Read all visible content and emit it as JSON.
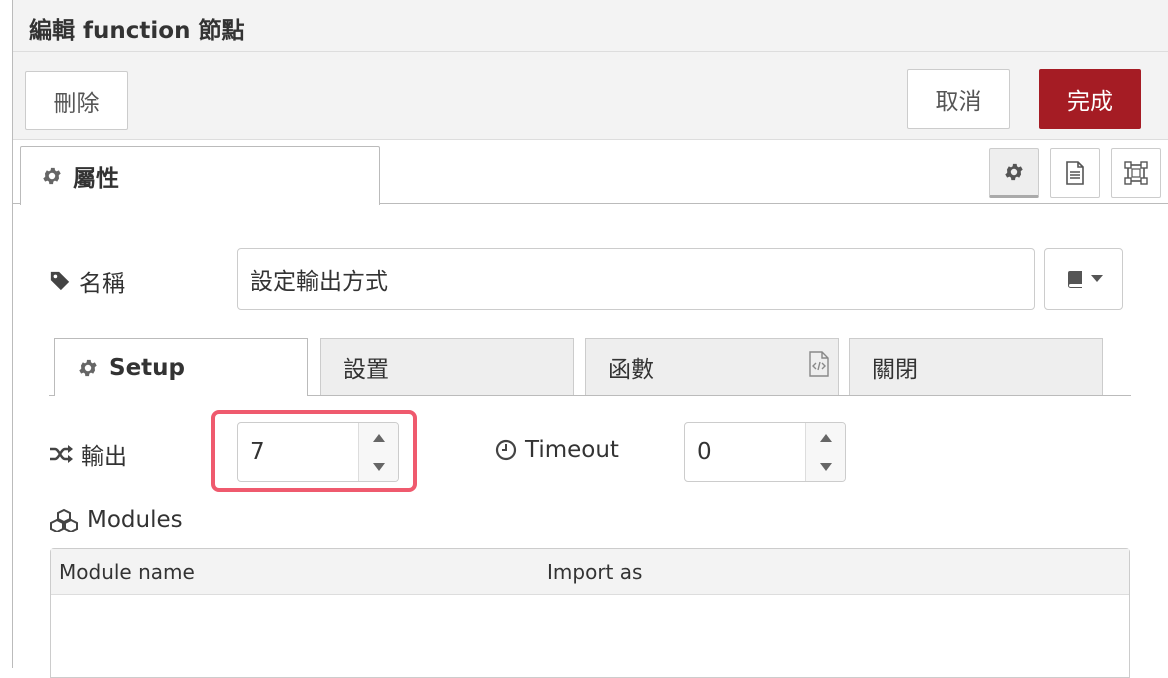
{
  "header": {
    "title": "編輯 function 節點"
  },
  "toolbar": {
    "delete_label": "刪除",
    "cancel_label": "取消",
    "done_label": "完成"
  },
  "tabs": {
    "properties_label": "屬性",
    "icons": [
      "gear-icon",
      "document-icon",
      "frame-icon"
    ]
  },
  "form": {
    "name_label": "名稱",
    "name_value": "設定輸出方式",
    "subtabs": [
      "Setup",
      "設置",
      "函數",
      "關閉"
    ],
    "outputs_label": "輸出",
    "outputs_value": "7",
    "timeout_label": "Timeout",
    "timeout_value": "0",
    "modules_label": "Modules",
    "modules_columns": [
      "Module name",
      "Import as"
    ]
  },
  "colors": {
    "accent": "#a51c24",
    "highlight": "#ef5a6e"
  }
}
